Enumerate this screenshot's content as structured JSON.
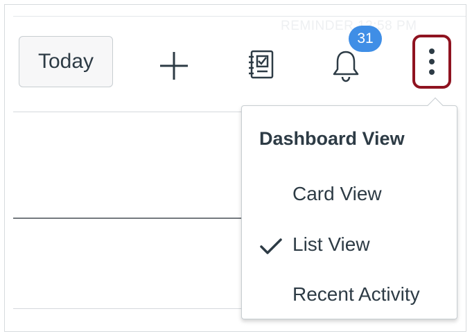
{
  "header": {
    "faded_reminder": "REMINDER 12:58 PM",
    "today_label": "Today",
    "notification_count": "31"
  },
  "icons": {
    "add": "plus-icon",
    "notes": "notebook-check-icon",
    "notifications": "bell-icon",
    "more": "vertical-ellipsis-icon",
    "selected": "checkmark-icon"
  },
  "colors": {
    "badge": "#3f8ee6",
    "more_button_outline": "#8f1320",
    "text": "#2d3b45"
  },
  "menu": {
    "heading": "Dashboard View",
    "items": [
      {
        "label": "Card View",
        "selected": false
      },
      {
        "label": "List View",
        "selected": true
      },
      {
        "label": "Recent Activity",
        "selected": false
      }
    ]
  }
}
